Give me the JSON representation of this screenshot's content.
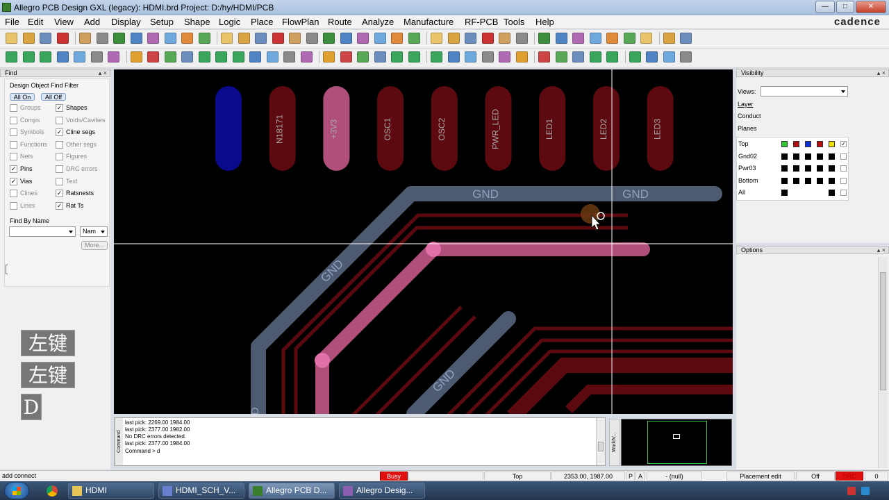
{
  "window": {
    "title": "Allegro PCB Design GXL (legacy): HDMI.brd  Project: D:/hy/HDMI/PCB",
    "brand": "cadence"
  },
  "menu": [
    "File",
    "Edit",
    "View",
    "Add",
    "Display",
    "Setup",
    "Shape",
    "Logic",
    "Place",
    "FlowPlan",
    "Route",
    "Analyze",
    "Manufacture",
    "RF-PCB",
    "Tools",
    "Help"
  ],
  "find": {
    "title": "Find",
    "filter_label": "Design Object Find Filter",
    "all_on": "All On",
    "all_off": "All Off",
    "items": [
      {
        "label": "Groups",
        "checked": false
      },
      {
        "label": "Shapes",
        "checked": true
      },
      {
        "label": "Comps",
        "checked": false
      },
      {
        "label": "Voids/Cavities",
        "checked": false
      },
      {
        "label": "Symbols",
        "checked": false
      },
      {
        "label": "Cline segs",
        "checked": true
      },
      {
        "label": "Functions",
        "checked": false
      },
      {
        "label": "Other segs",
        "checked": false
      },
      {
        "label": "Nets",
        "checked": false
      },
      {
        "label": "Figures",
        "checked": false
      },
      {
        "label": "Pins",
        "checked": true
      },
      {
        "label": "DRC errors",
        "checked": false
      },
      {
        "label": "Vias",
        "checked": true
      },
      {
        "label": "Text",
        "checked": false
      },
      {
        "label": "Clines",
        "checked": false
      },
      {
        "label": "Ratsnests",
        "checked": true
      },
      {
        "label": "Lines",
        "checked": false
      },
      {
        "label": "Rat Ts",
        "checked": true
      }
    ],
    "find_by_name": "Find By Name",
    "name_select": "Nam",
    "more": "More..."
  },
  "keys": [
    "左键",
    "左键",
    "D"
  ],
  "canvas": {
    "pads": [
      {
        "label": "",
        "color": "#0a0a8c"
      },
      {
        "label": "N18171",
        "color": "#5c0a10"
      },
      {
        "label": "+3V3",
        "color": "#b0507a"
      },
      {
        "label": "OSC1",
        "color": "#5c0a10"
      },
      {
        "label": "OSC2",
        "color": "#5c0a10"
      },
      {
        "label": "PWR_LED",
        "color": "#5c0a10"
      },
      {
        "label": "LED1",
        "color": "#5c0a10"
      },
      {
        "label": "LED2",
        "color": "#5c0a10"
      },
      {
        "label": "LED3",
        "color": "#5c0a10"
      }
    ],
    "net_labels": [
      "GND",
      "GND",
      "GND",
      "GND",
      "D"
    ]
  },
  "console": {
    "tab": "Command",
    "lines": [
      "last pick:  2269.00 1984.00",
      "last pick:  2377.00 1982.00",
      "No DRC errors detected.",
      "last pick:  2377.00 1984.00",
      "Command > d"
    ]
  },
  "worldview": {
    "tab": "WorldV..."
  },
  "visibility": {
    "title": "Visibility",
    "views_label": "Views:",
    "layer_label": "Layer",
    "conductors_label": "Conduct",
    "planes_label": "Planes",
    "rows": [
      "Top",
      "Gnd02",
      "Pwr03",
      "Bottom",
      "All"
    ]
  },
  "options": {
    "title": "Options"
  },
  "status": {
    "command": "add connect",
    "busy": "Busy",
    "layer": "Top",
    "coords": "2353.00, 1987.00",
    "p": "P",
    "a": "A",
    "null": "- (null)",
    "mode": "Placement edit",
    "off": "Off",
    "drc": "DRC",
    "count": "0"
  },
  "taskbar": {
    "items": [
      "HDMI",
      "HDMI_SCH_V...",
      "Allegro PCB D...",
      "Allegro Desig..."
    ]
  }
}
